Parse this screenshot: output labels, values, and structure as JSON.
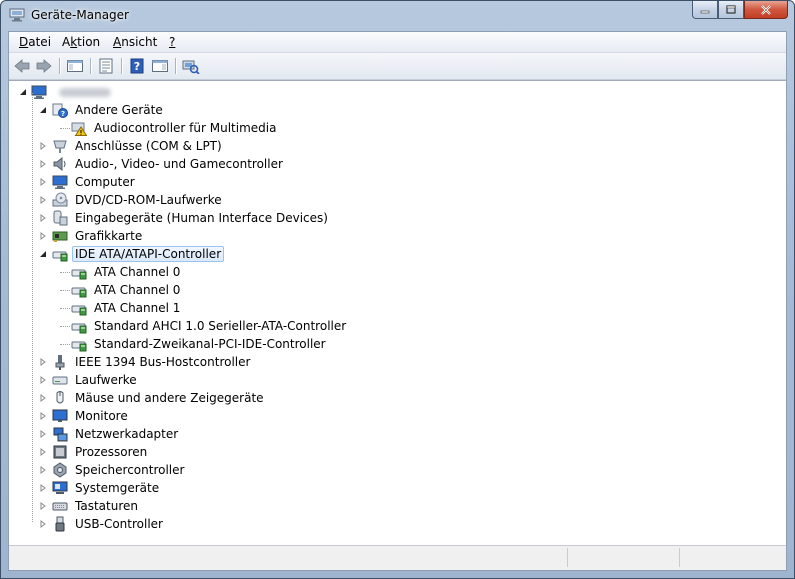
{
  "window": {
    "title": "Geräte-Manager"
  },
  "menu": [
    {
      "label": "Datei",
      "accel": "D"
    },
    {
      "label": "Aktion",
      "accel": "k"
    },
    {
      "label": "Ansicht",
      "accel": "A"
    },
    {
      "label": "?",
      "accel": "?"
    }
  ],
  "toolbar": [
    "back-icon",
    "forward-icon",
    "show-hide-console-tree-icon",
    "properties-icon",
    "help-icon",
    "action-pane-icon",
    "scan-hardware-icon"
  ],
  "tree": {
    "root": {
      "label": "",
      "expanded": true
    },
    "categories": [
      {
        "label": "Andere Geräte",
        "icon": "unknown-device-icon",
        "expanded": true,
        "children": [
          {
            "label": "Audiocontroller für Multimedia",
            "icon": "warning-device-icon"
          }
        ]
      },
      {
        "label": "Anschlüsse (COM & LPT)",
        "icon": "port-icon",
        "expanded": false
      },
      {
        "label": "Audio-, Video- und Gamecontroller",
        "icon": "speaker-icon",
        "expanded": false
      },
      {
        "label": "Computer",
        "icon": "computer-icon",
        "expanded": false
      },
      {
        "label": "DVD/CD-ROM-Laufwerke",
        "icon": "dvd-drive-icon",
        "expanded": false
      },
      {
        "label": "Eingabegeräte (Human Interface Devices)",
        "icon": "hid-icon",
        "expanded": false
      },
      {
        "label": "Grafikkarte",
        "icon": "display-adapter-icon",
        "expanded": false
      },
      {
        "label": "IDE ATA/ATAPI-Controller",
        "icon": "ide-controller-icon",
        "expanded": true,
        "selected": true,
        "children": [
          {
            "label": "ATA Channel 0",
            "icon": "ide-controller-icon"
          },
          {
            "label": "ATA Channel 0",
            "icon": "ide-controller-icon"
          },
          {
            "label": "ATA Channel 1",
            "icon": "ide-controller-icon"
          },
          {
            "label": "Standard AHCI 1.0 Serieller-ATA-Controller",
            "icon": "ide-controller-icon"
          },
          {
            "label": "Standard-Zweikanal-PCI-IDE-Controller",
            "icon": "ide-controller-icon"
          }
        ]
      },
      {
        "label": "IEEE 1394 Bus-Hostcontroller",
        "icon": "firewire-icon",
        "expanded": false
      },
      {
        "label": "Laufwerke",
        "icon": "disk-drive-icon",
        "expanded": false
      },
      {
        "label": "Mäuse und andere Zeigegeräte",
        "icon": "mouse-icon",
        "expanded": false
      },
      {
        "label": "Monitore",
        "icon": "monitor-icon",
        "expanded": false
      },
      {
        "label": "Netzwerkadapter",
        "icon": "network-adapter-icon",
        "expanded": false
      },
      {
        "label": "Prozessoren",
        "icon": "processor-icon",
        "expanded": false
      },
      {
        "label": "Speichercontroller",
        "icon": "storage-controller-icon",
        "expanded": false
      },
      {
        "label": "Systemgeräte",
        "icon": "system-device-icon",
        "expanded": false
      },
      {
        "label": "Tastaturen",
        "icon": "keyboard-icon",
        "expanded": false
      },
      {
        "label": "USB-Controller",
        "icon": "usb-icon",
        "expanded": false
      }
    ]
  },
  "colors": {
    "selection_border": "#9bc3ee",
    "selection_fill": "#dbeafc",
    "close_button": "#c94a30",
    "warning": "#f5c518"
  }
}
